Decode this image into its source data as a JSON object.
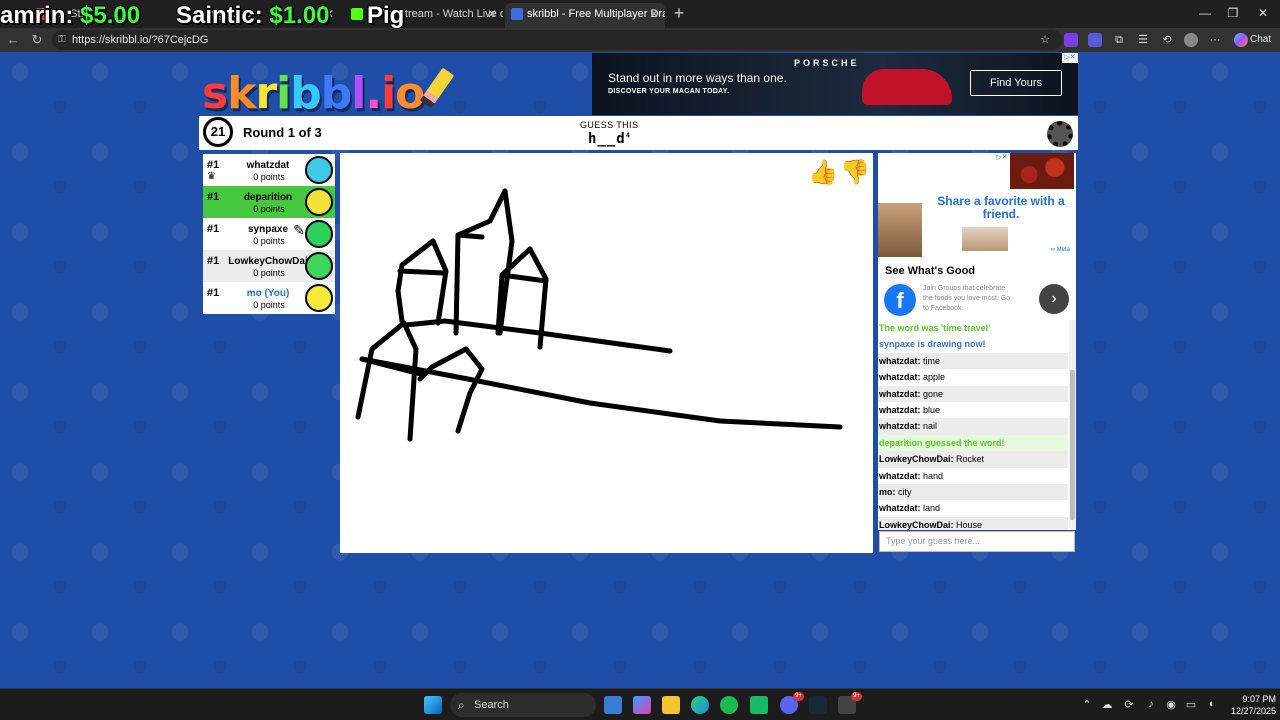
{
  "browser": {
    "tabs": [
      {
        "label": "amrin: $5.00",
        "partial": "P... St..."
      },
      {
        "label": "Saintic: $1.00",
        "partial": "...ng ...ers"
      },
      {
        "label": "... the Stream - Watch Live o",
        "overlay": "Pig"
      },
      {
        "label": "skribbl - Free Multiplayer Drawing"
      }
    ],
    "url": "https://skribbl.io/?67CejcDG",
    "chat_button": "Chat"
  },
  "overlay": {
    "donation1_name": "amrin:",
    "donation1_amount": "$5.00",
    "donation2_name": "Saintic:",
    "donation2_amount": "$1.00",
    "donation3_name": "Pig"
  },
  "logo": {
    "letters": [
      "s",
      "k",
      "r",
      "i",
      "b",
      "b",
      "l",
      ".",
      "i",
      "o"
    ],
    "colors": [
      "#ff3b3b",
      "#ff8b2c",
      "#ffe52f",
      "#63e34a",
      "#36c9ff",
      "#3f78ff",
      "#b44cff",
      "#ff4fc3",
      "#ff3b3b",
      "#ff8b2c"
    ]
  },
  "ad_top": {
    "headline": "Stand out in more ways than one.",
    "subline": "DISCOVER YOUR MACAN TODAY.",
    "brand": "PORSCHE",
    "cta": "Find Yours"
  },
  "game": {
    "timer": "21",
    "round": "Round 1 of 3",
    "guess_label": "GUESS THIS",
    "hint": "h__d",
    "hint_count": "4"
  },
  "players": [
    {
      "rank": "#1",
      "name": "whatzdat",
      "points": "0 points",
      "avatar_color": "#3ec9e6",
      "crown": true
    },
    {
      "rank": "#1",
      "name": "deparition",
      "points": "0 points",
      "avatar_color": "#f2e23a",
      "guessed": true
    },
    {
      "rank": "#1",
      "name": "synpaxe",
      "points": "0 points",
      "avatar_color": "#2ccf5a",
      "drawing": true
    },
    {
      "rank": "#1",
      "name": "LowkeyChowDai",
      "points": "0 points",
      "avatar_color": "#3fd45b"
    },
    {
      "rank": "#1",
      "name": "mo (You)",
      "points": "0 points",
      "avatar_color": "#f5e93a",
      "you": true
    }
  ],
  "side_ad": {
    "title": "Share a favorite with a friend.",
    "headline": "See What's Good",
    "desc": "Join Groups that celebrate the foods you love most. Go to Facebook.",
    "meta": "∞ Meta"
  },
  "chat": {
    "messages": [
      {
        "type": "green",
        "text": "The word was 'time travel'"
      },
      {
        "type": "blue",
        "text": "synpaxe is drawing now!"
      },
      {
        "type": "msg",
        "user": "whatzdat:",
        "text": "time"
      },
      {
        "type": "msg",
        "user": "whatzdat:",
        "text": "apple"
      },
      {
        "type": "msg",
        "user": "whatzdat:",
        "text": "gone"
      },
      {
        "type": "msg",
        "user": "whatzdat:",
        "text": "blue"
      },
      {
        "type": "msg",
        "user": "whatzdat:",
        "text": "nail"
      },
      {
        "type": "gbg",
        "text": "deparition guessed the word!"
      },
      {
        "type": "msg",
        "user": "LowkeyChowDai:",
        "text": "Rocket"
      },
      {
        "type": "msg",
        "user": "whatzdat:",
        "text": "hand"
      },
      {
        "type": "msg",
        "user": "mo:",
        "text": "city"
      },
      {
        "type": "msg",
        "user": "whatzdat:",
        "text": "land"
      },
      {
        "type": "msg",
        "user": "LowkeyChowDai:",
        "text": "House"
      }
    ],
    "placeholder": "Type your guess here..."
  },
  "taskbar": {
    "search": "Search",
    "time": "9:07 PM",
    "date": "12/27/2025",
    "badge1": "9+",
    "badge2": "9+"
  }
}
